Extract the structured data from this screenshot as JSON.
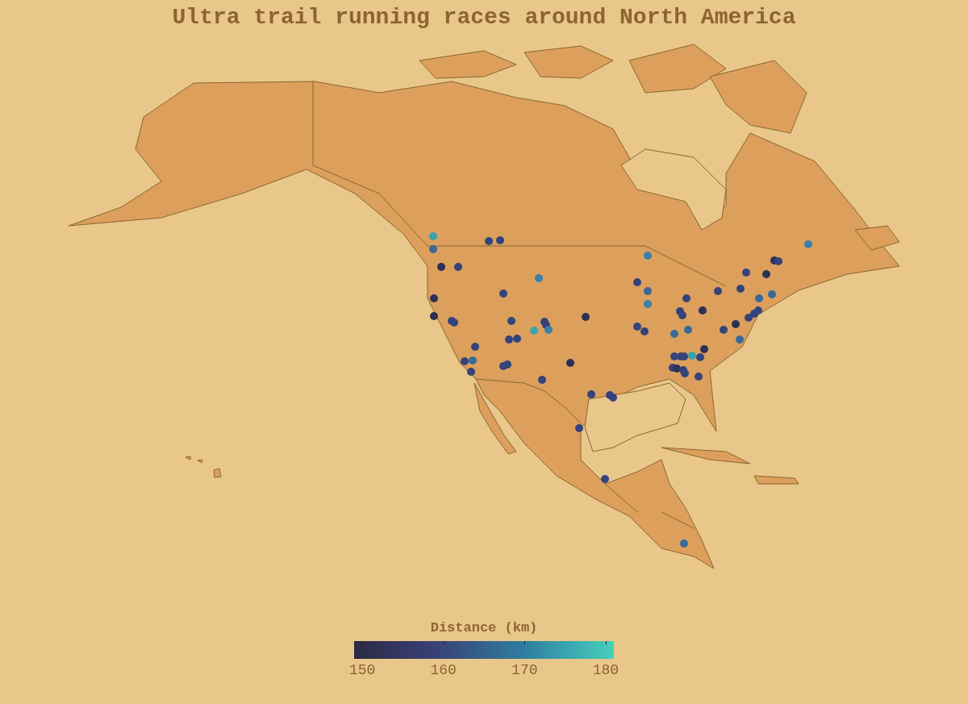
{
  "title": "Ultra trail running races around North America",
  "colorbar": {
    "title": "Distance (km)",
    "ticks": [
      "150",
      "160",
      "170",
      "180"
    ]
  }
}
